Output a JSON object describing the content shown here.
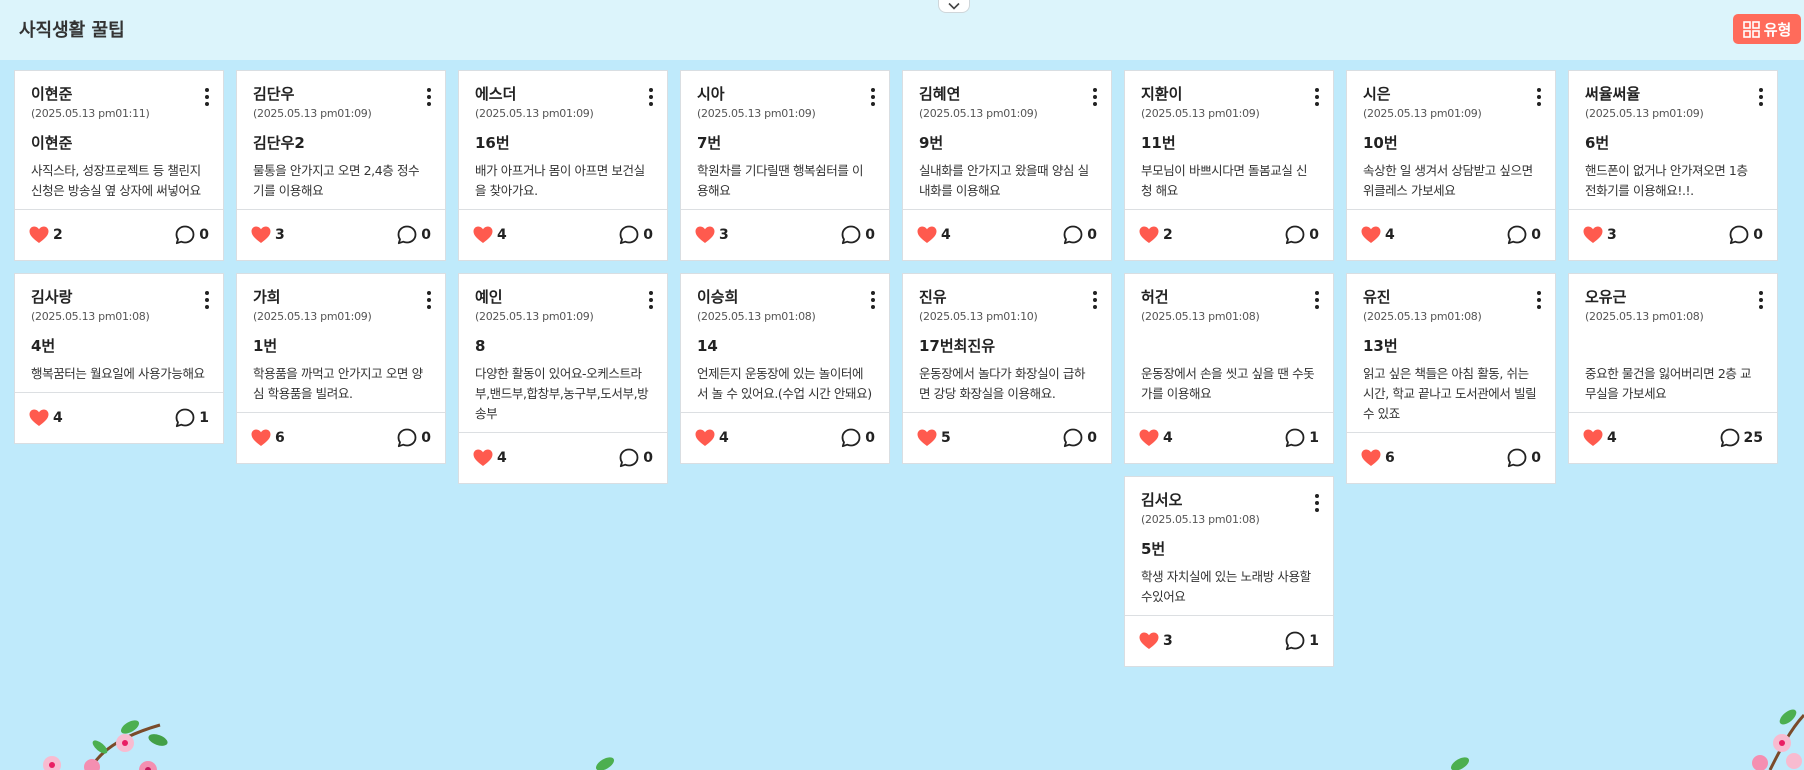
{
  "header": {
    "title": "사직생활 꿀팁",
    "type_button": "유형"
  },
  "colors": {
    "background": "#bfeafb",
    "header": "#dcf4fb",
    "accent": "#ff6b5b",
    "heart": "#ff5a4e"
  },
  "icons": {
    "like": "heart-icon",
    "comment": "comment-icon",
    "menu": "kebab-menu-icon",
    "type": "grid-icon",
    "collapse": "chevron-down-icon"
  },
  "columns": [
    [
      {
        "author": "이현준",
        "date": "(2025.05.13 pm01:11)",
        "title": "이현준",
        "body": "사직스타, 성장프로젝트 등 챌린지 신청은 방송실 옆 상자에 써넣어요",
        "likes": "2",
        "comments": "0"
      },
      {
        "author": "김사랑",
        "date": "(2025.05.13 pm01:08)",
        "title": "4번",
        "body": "행복꿈터는 월요일에 사용가능해요",
        "likes": "4",
        "comments": "1"
      }
    ],
    [
      {
        "author": "김단우",
        "date": "(2025.05.13 pm01:09)",
        "title": "김단우2",
        "body": "물통을 안가지고 오면 2,4층 정수기를 이용해요",
        "likes": "3",
        "comments": "0"
      },
      {
        "author": "가희",
        "date": "(2025.05.13 pm01:09)",
        "title": "1번",
        "body": "학용품을 까먹고 안가지고 오면 양심 학용품을 빌려요.",
        "likes": "6",
        "comments": "0"
      }
    ],
    [
      {
        "author": "에스더",
        "date": "(2025.05.13 pm01:09)",
        "title": "16번",
        "body": "배가 아프거나 몸이 아프면 보건실을 찾아가요.",
        "likes": "4",
        "comments": "0"
      },
      {
        "author": "예인",
        "date": "(2025.05.13 pm01:09)",
        "title": "8",
        "body": "다양한 활동이 있어요-오케스트라부,밴드부,합창부,농구부,도서부,방송부",
        "likes": "4",
        "comments": "0"
      }
    ],
    [
      {
        "author": "시아",
        "date": "(2025.05.13 pm01:09)",
        "title": "7번",
        "body": "학원차를 기다릴땐 행복쉼터를 이용해요",
        "likes": "3",
        "comments": "0"
      },
      {
        "author": "이승희",
        "date": "(2025.05.13 pm01:08)",
        "title": "14",
        "body": "언제든지 운동장에 있는 놀이터에서 놀 수 있어요.(수업 시간 안돼요)",
        "likes": "4",
        "comments": "0"
      }
    ],
    [
      {
        "author": "김혜연",
        "date": "(2025.05.13 pm01:09)",
        "title": "9번",
        "body": "실내화를 안가지고 왔을때 양심 실내화를 이용해요",
        "likes": "4",
        "comments": "0"
      },
      {
        "author": "진유",
        "date": "(2025.05.13 pm01:10)",
        "title": "17번최진유",
        "body": "운동장에서 놀다가 화장실이 급하면 강당 화장실을 이용해요.",
        "likes": "5",
        "comments": "0"
      }
    ],
    [
      {
        "author": "지환이",
        "date": "(2025.05.13 pm01:09)",
        "title": "11번",
        "body": "부모님이 바쁘시다면 돌봄교실 신청 해요",
        "likes": "2",
        "comments": "0"
      },
      {
        "author": "허건",
        "date": "(2025.05.13 pm01:08)",
        "title": "",
        "body": "운동장에서 손을 씻고 싶을 땐 수돗가를 이용해요",
        "likes": "4",
        "comments": "1"
      },
      {
        "author": "김서오",
        "date": "(2025.05.13 pm01:08)",
        "title": "5번",
        "body": "학생 자치실에 있는 노래방 사용할수있어요",
        "likes": "3",
        "comments": "1"
      }
    ],
    [
      {
        "author": "시은",
        "date": "(2025.05.13 pm01:09)",
        "title": "10번",
        "body": "속상한 일 생겨서 상담받고 싶으면 위클레스 가보세요",
        "likes": "4",
        "comments": "0"
      },
      {
        "author": "유진",
        "date": "(2025.05.13 pm01:08)",
        "title": "13번",
        "body": "읽고 싶은 책들은 아침 활동, 쉬는 시간, 학교 끝나고 도서관에서 빌릴 수 있죠",
        "likes": "6",
        "comments": "0"
      }
    ],
    [
      {
        "author": "써율써율",
        "date": "(2025.05.13 pm01:09)",
        "title": "6번",
        "body": "핸드폰이 없거나 안가져오면 1층 전화기를 이용해요!.!.",
        "likes": "3",
        "comments": "0"
      },
      {
        "author": "오유근",
        "date": "(2025.05.13 pm01:08)",
        "title": "",
        "body": "중요한 물건을 잃어버리면 2층 교무실을 가보세요",
        "likes": "4",
        "comments": "25"
      }
    ]
  ]
}
